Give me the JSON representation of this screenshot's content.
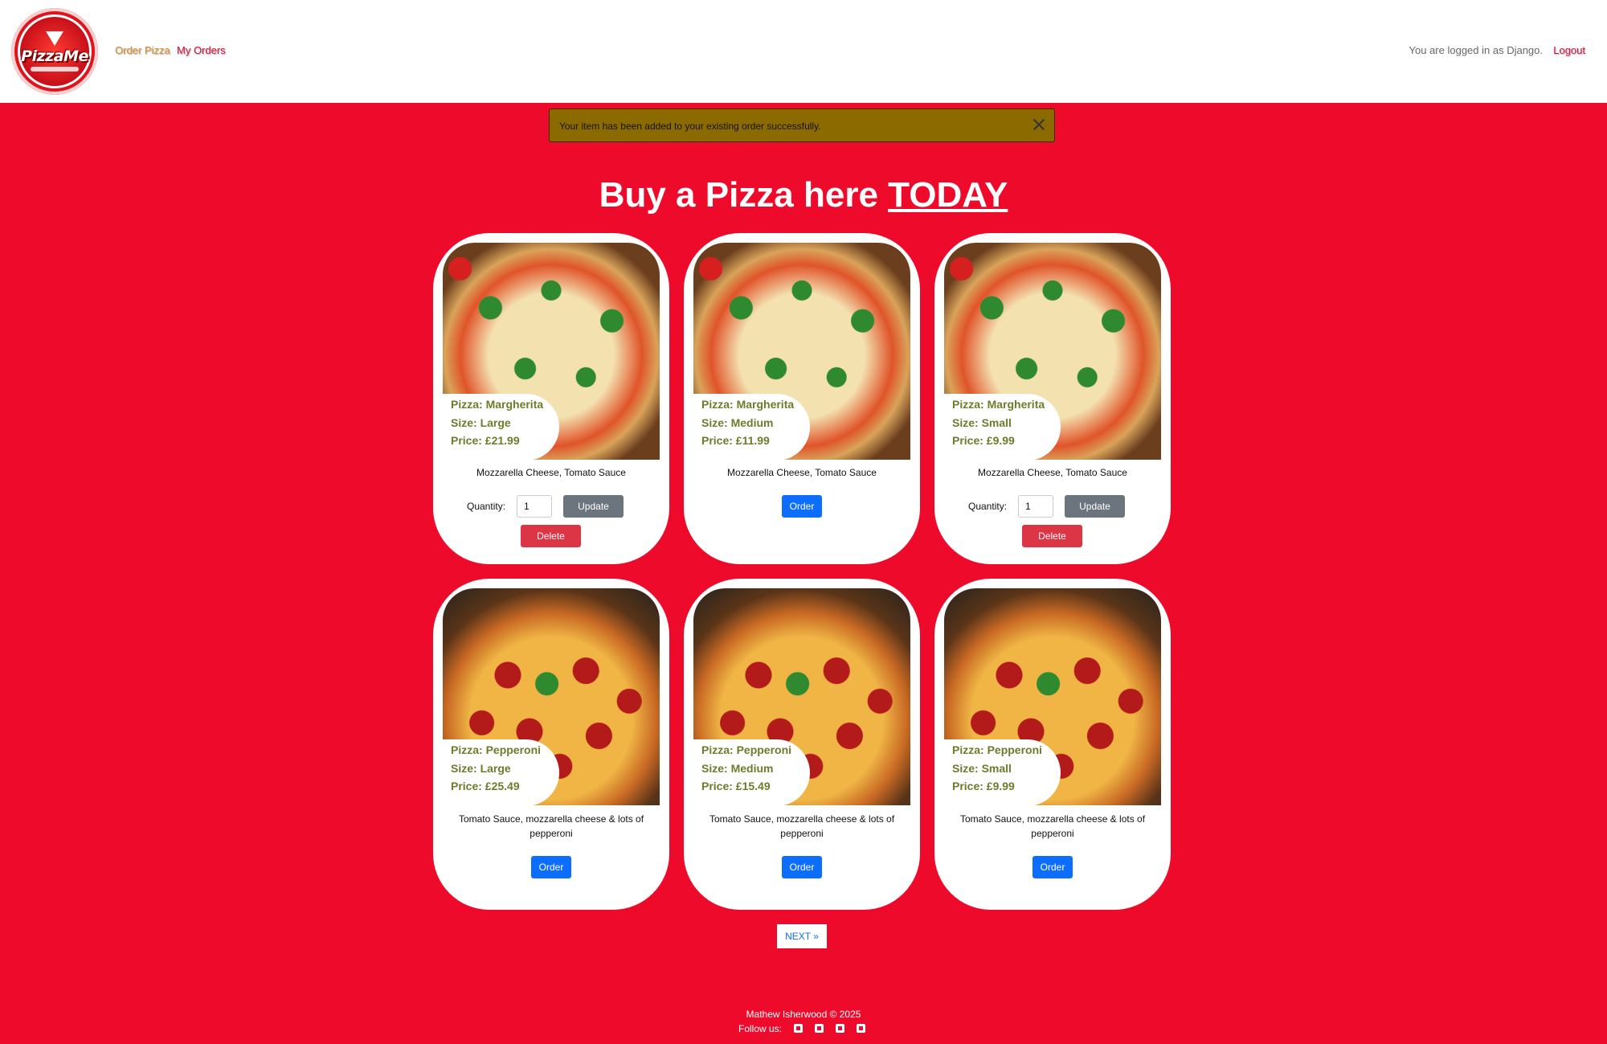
{
  "nav": {
    "brand": "PizzaMe",
    "links": [
      "Order Pizza",
      "My Orders"
    ],
    "status_text": "You are logged in as Django.",
    "logout_label": "Logout"
  },
  "alert": {
    "message": "Your item has been added to your existing order successfully."
  },
  "heading": {
    "prefix": "Buy a Pizza here ",
    "emphasis": "TODAY"
  },
  "cards": [
    {
      "pizza": "Pizza: Margherita",
      "size": "Size: Large",
      "price": "Price: £21.99",
      "description": "Mozzarella Cheese, Tomato Sauce",
      "mode": "update",
      "quantity_label": "Quantity:",
      "quantity": "1",
      "update_label": "Update",
      "delete_label": "Delete"
    },
    {
      "pizza": "Pizza: Margherita",
      "size": "Size: Medium",
      "price": "Price: £11.99",
      "description": "Mozzarella Cheese, Tomato Sauce",
      "mode": "order",
      "order_label": "Order"
    },
    {
      "pizza": "Pizza: Margherita",
      "size": "Size: Small",
      "price": "Price: £9.99",
      "description": "Mozzarella Cheese, Tomato Sauce",
      "mode": "update",
      "quantity_label": "Quantity:",
      "quantity": "1",
      "update_label": "Update",
      "delete_label": "Delete"
    },
    {
      "pizza": "Pizza: Pepperoni",
      "size": "Size: Large",
      "price": "Price: £25.49",
      "description": "Tomato Sauce, mozzarella cheese & lots of pepperoni",
      "mode": "order",
      "order_label": "Order"
    },
    {
      "pizza": "Pizza: Pepperoni",
      "size": "Size: Medium",
      "price": "Price: £15.49",
      "description": "Tomato Sauce, mozzarella cheese & lots of pepperoni",
      "mode": "order",
      "order_label": "Order"
    },
    {
      "pizza": "Pizza: Pepperoni",
      "size": "Size: Small",
      "price": "Price: £9.99",
      "description": "Tomato Sauce, mozzarella cheese & lots of pepperoni",
      "mode": "order",
      "order_label": "Order"
    }
  ],
  "pagination": {
    "next_label": "NEXT »"
  },
  "footer": {
    "copyright": "Mathew Isherwood © 2025",
    "follow_label": "Follow us:",
    "social_icons": [
      "facebook-icon",
      "twitter-icon",
      "instagram-icon",
      "youtube-icon"
    ]
  },
  "colors": {
    "background": "#ee0a2a",
    "order_button": "#0d6efd",
    "update_button": "#6c757d",
    "delete_button": "#dc3545",
    "alert": "#8b6b00",
    "card_text": "#6f7a2a"
  }
}
